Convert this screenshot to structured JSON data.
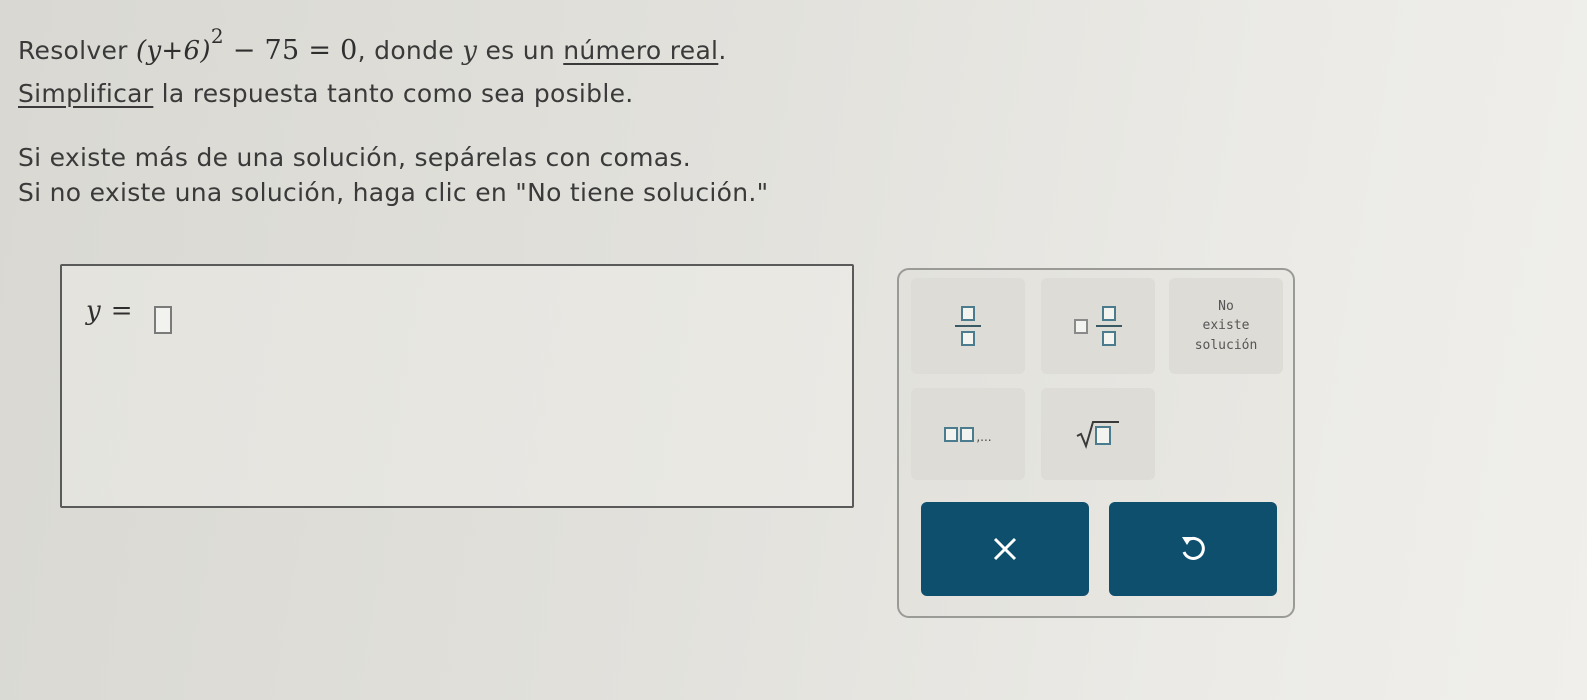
{
  "problem": {
    "resolver": "Resolver",
    "equation_base": "(y+6)",
    "equation_exponent": "2",
    "equation_rest": "− 75 = 0",
    "donde": ", donde",
    "variable": "y",
    "es_un": "es un",
    "numero_real": "número real",
    "period": ".",
    "simplificar": "Simplificar",
    "line2_rest": "la respuesta tanto como sea posible.",
    "line3": "Si existe más de una solución, sepárelas con comas.",
    "line4": "Si no existe una solución, haga clic en \"No tiene solución.\""
  },
  "answer": {
    "variable": "y",
    "equals": "="
  },
  "keypad": {
    "nosol_line1": "No",
    "nosol_line2": "existe",
    "nosol_line3": "solución",
    "list_separator": ",...",
    "clear_icon": "x-icon",
    "undo_icon": "undo-icon"
  },
  "colors": {
    "button_bg": "#0e4f6d",
    "slot_border": "#4a7c8e"
  }
}
